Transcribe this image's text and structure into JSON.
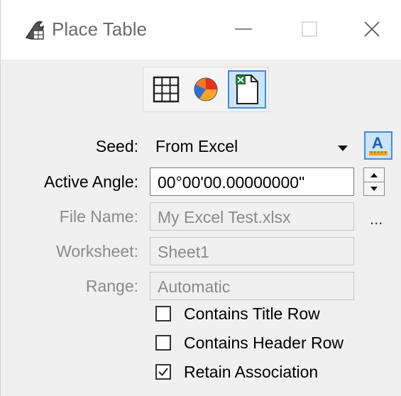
{
  "window": {
    "title": "Place Table",
    "controls": {
      "minimize": "minimize",
      "maximize": "maximize",
      "close": "close"
    }
  },
  "modes": [
    {
      "icon": "table-grid-icon",
      "selected": false
    },
    {
      "icon": "pie-chart-icon",
      "selected": false
    },
    {
      "icon": "excel-file-icon",
      "selected": true
    }
  ],
  "form": {
    "seed": {
      "label": "Seed:",
      "value": "From Excel"
    },
    "active_angle": {
      "label": "Active Angle:",
      "value": "00°00'00.00000000\""
    },
    "file_name": {
      "label": "File Name:",
      "value": "My Excel Test.xlsx",
      "browse": "..."
    },
    "worksheet": {
      "label": "Worksheet:",
      "value": "Sheet1"
    },
    "range": {
      "label": "Range:",
      "value": "Automatic"
    }
  },
  "options": {
    "contains_title_row": {
      "label": "Contains Title Row",
      "checked": false
    },
    "contains_header_row": {
      "label": "Contains Header Row",
      "checked": false
    },
    "retain_association": {
      "label": "Retain Association",
      "checked": true
    }
  },
  "colors": {
    "selected_fill": "#cce4f7",
    "selected_border": "#3d8ee0",
    "disabled_text": "#8a8a8a"
  }
}
